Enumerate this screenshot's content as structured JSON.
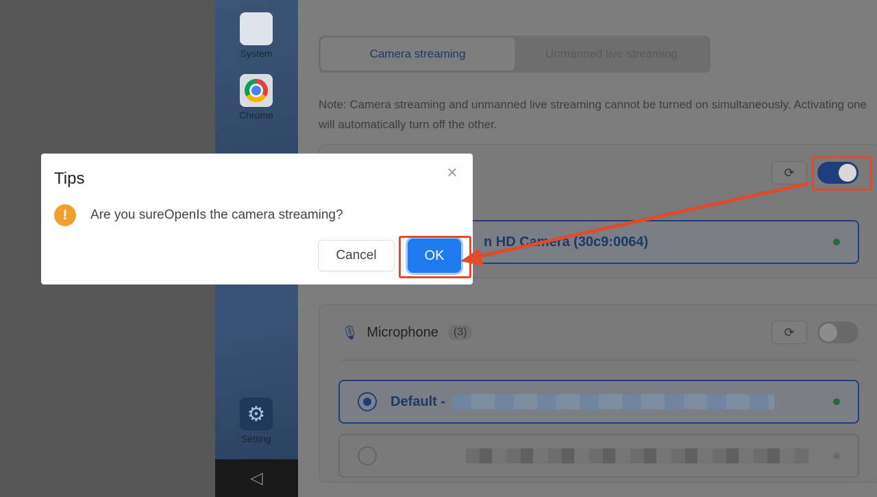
{
  "phone": {
    "apps": [
      {
        "label": "System",
        "icon": "system-grid-icon"
      },
      {
        "label": "Chrome",
        "icon": "chrome-icon"
      },
      {
        "label": "Setting",
        "icon": "gear-icon"
      }
    ],
    "nav_back": "◁"
  },
  "panel": {
    "tabs": [
      {
        "label": "Camera streaming",
        "active": true
      },
      {
        "label": "Unmanned live streaming",
        "active": false
      }
    ],
    "note": "Note: Camera streaming and unmanned live streaming cannot be turned on simultaneously. Activating one will automatically turn off the other.",
    "camera": {
      "toggle_on": true,
      "device_name": "n HD Camera (30c9:0064)"
    },
    "microphone": {
      "title": "Microphone",
      "count": "(3)",
      "toggle_on": false,
      "devices": [
        {
          "name": "Default -",
          "selected": true
        },
        {
          "name": "",
          "selected": false
        }
      ]
    }
  },
  "dialog": {
    "title": "Tips",
    "message": "Are you sureOpenIs the camera streaming?",
    "cancel_label": "Cancel",
    "ok_label": "OK"
  },
  "colors": {
    "primary": "#1e7bf0",
    "highlight": "#e24a2d",
    "warning": "#f0a030"
  }
}
